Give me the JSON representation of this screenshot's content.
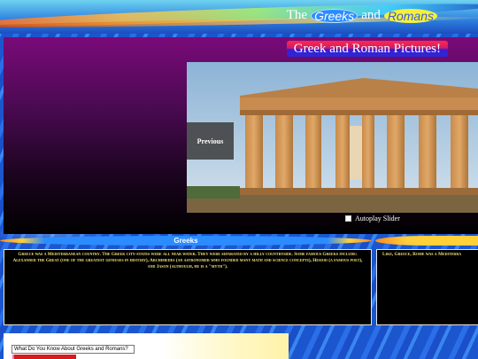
{
  "header": {
    "title_prefix": "The",
    "title_greeks": "Greeks",
    "title_and": "and",
    "title_romans": "Romans"
  },
  "slider": {
    "title": "Greek and Roman Pictures!",
    "previous_label": "Previous",
    "autoplay_label": "Autoplay Slider"
  },
  "greeks": {
    "heading": "Greeks",
    "text": "Greece was a Mediterranean country. The Greek city-states were all near water. They were separated by a hilly countryside. Some famous Greeks include: Alexander the Great (one of the greatest geniuses in history), Archimedes (an astronomer who founded many math and science concepts), Hesiod (a famous poet), and Jason (although, he is a \"myth\")."
  },
  "romans": {
    "text": "Like, Greece, Rome was a Mediterra"
  },
  "quiz": {
    "question": "What Do You Know About Greeks and Romans?"
  }
}
